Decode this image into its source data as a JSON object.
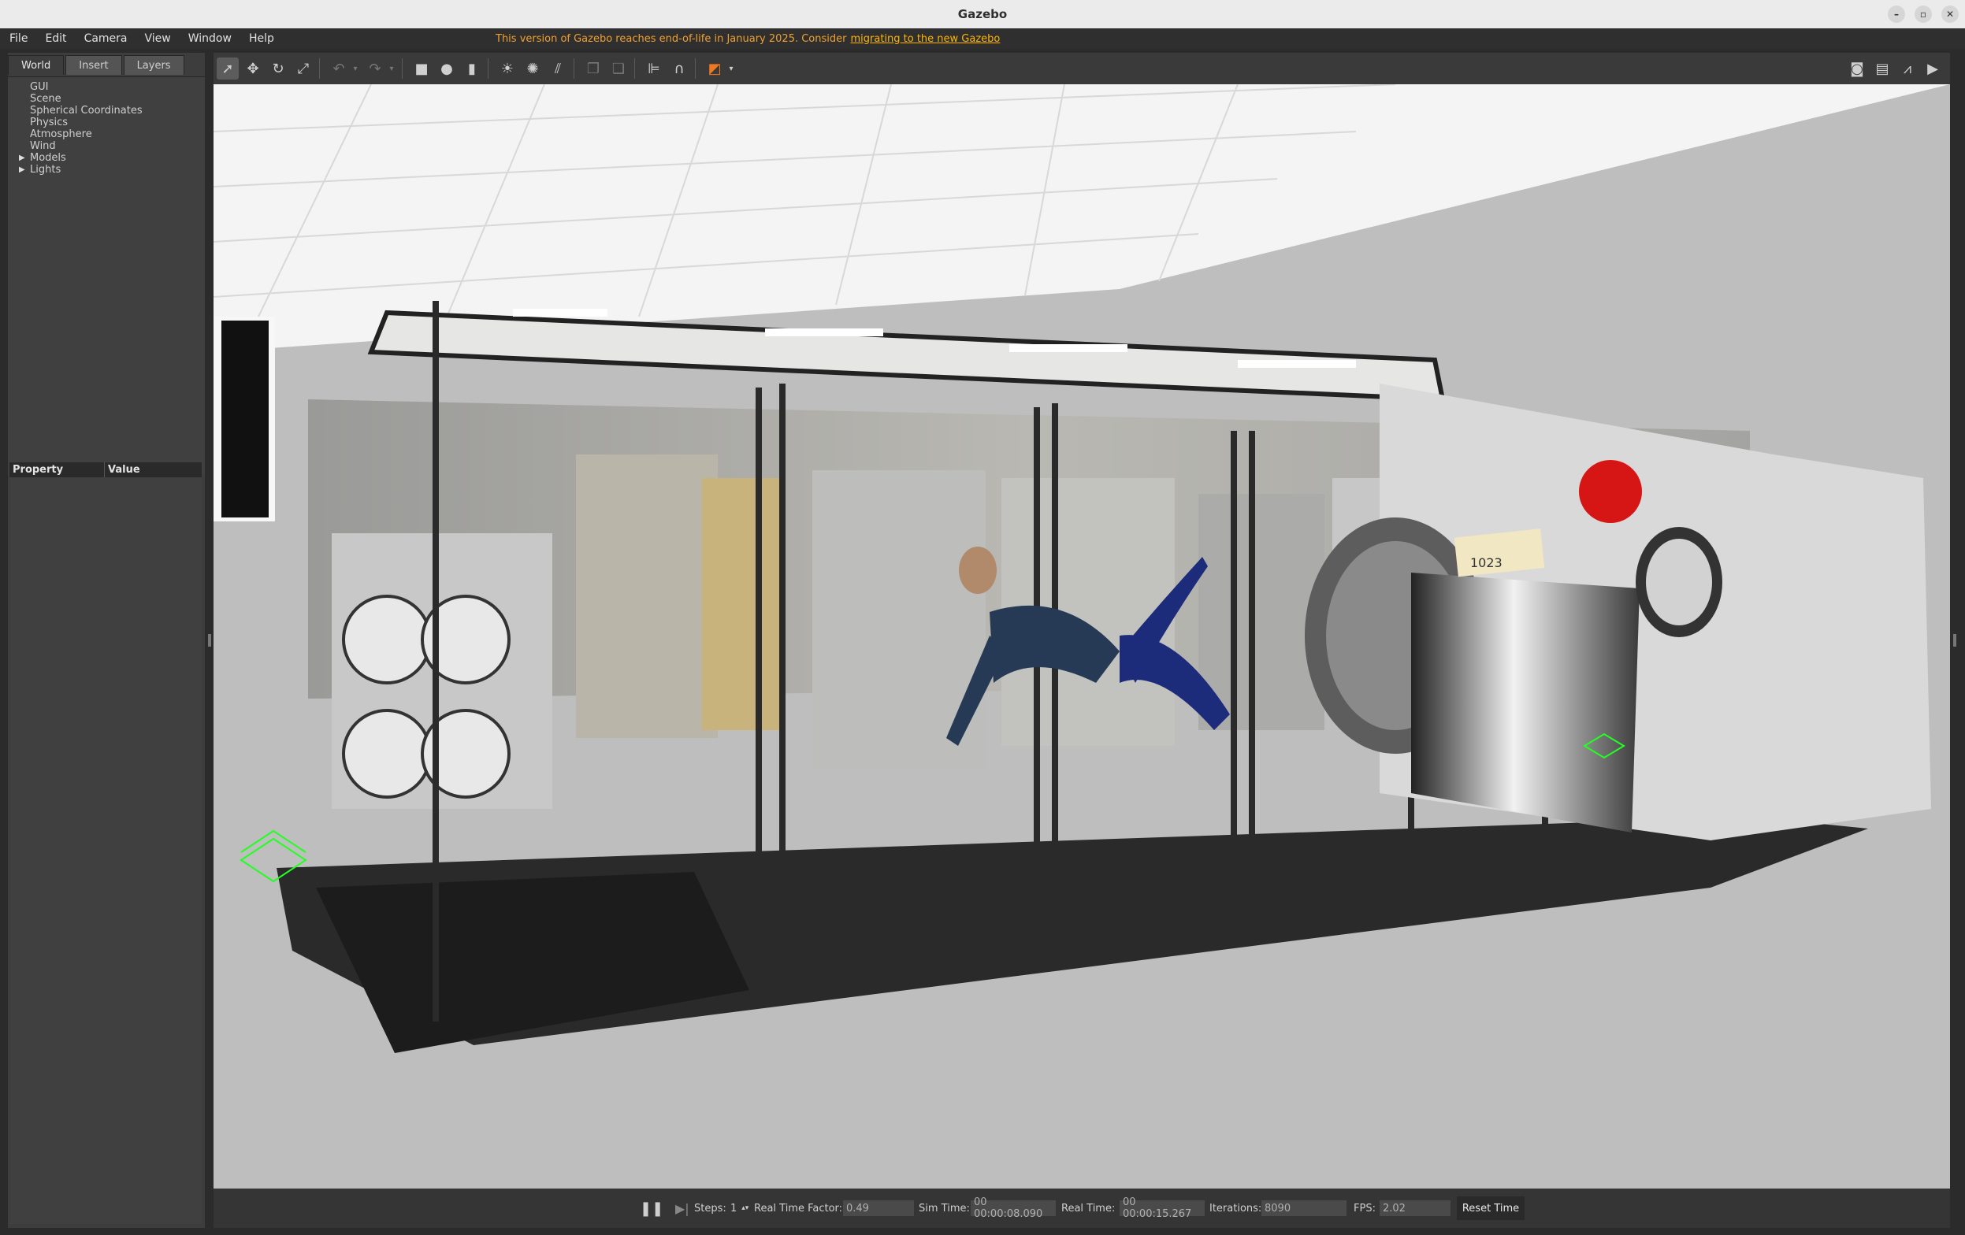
{
  "window": {
    "title": "Gazebo"
  },
  "menu": {
    "items": [
      "File",
      "Edit",
      "Camera",
      "View",
      "Window",
      "Help"
    ]
  },
  "banner": {
    "text": "This version of Gazebo reaches end-of-life in January 2025. Consider",
    "link": "migrating to the new Gazebo"
  },
  "left_panel": {
    "tabs": [
      "World",
      "Insert",
      "Layers"
    ],
    "tree": [
      {
        "label": "GUI",
        "expandable": false
      },
      {
        "label": "Scene",
        "expandable": false
      },
      {
        "label": "Spherical Coordinates",
        "expandable": false
      },
      {
        "label": "Physics",
        "expandable": false
      },
      {
        "label": "Atmosphere",
        "expandable": false
      },
      {
        "label": "Wind",
        "expandable": false
      },
      {
        "label": "Models",
        "expandable": true
      },
      {
        "label": "Lights",
        "expandable": true
      }
    ],
    "properties": {
      "col_property": "Property",
      "col_value": "Value"
    }
  },
  "toolbar": {
    "tools": [
      "select-arrow-icon",
      "translate-icon",
      "rotate-icon",
      "scale-icon",
      "undo-icon",
      "redo-icon",
      "box-icon",
      "sphere-icon",
      "cylinder-icon",
      "point-light-icon",
      "spot-light-icon",
      "directional-light-icon",
      "copy-icon",
      "paste-icon",
      "align-icon",
      "snap-icon",
      "view-angle-icon"
    ],
    "right_tools": [
      "screenshot-icon",
      "log-icon",
      "plot-icon",
      "record-video-icon"
    ]
  },
  "scene": {
    "hatch_label": "1023"
  },
  "bottom": {
    "steps_label": "Steps:",
    "steps_value": "1",
    "rtf_label": "Real Time Factor:",
    "rtf_value": "0.49",
    "sim_time_label": "Sim Time:",
    "sim_time_value": "00 00:00:08.090",
    "real_time_label": "Real Time:",
    "real_time_value": "00 00:00:15.267",
    "iterations_label": "Iterations:",
    "iterations_value": "8090",
    "fps_label": "FPS:",
    "fps_value": "2.02",
    "reset_label": "Reset Time"
  }
}
